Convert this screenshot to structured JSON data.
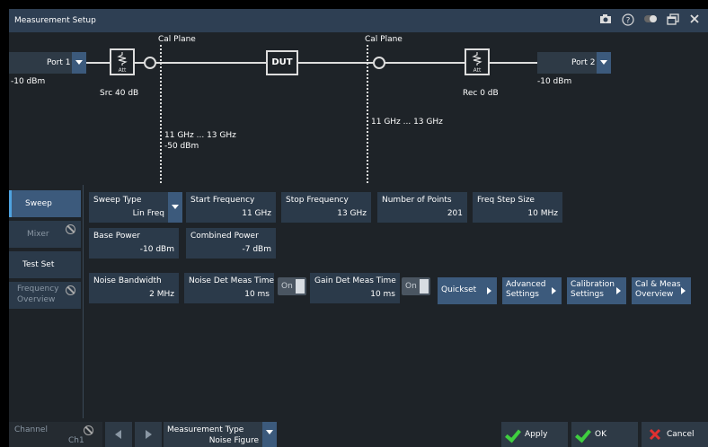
{
  "window": {
    "title": "Measurement Setup"
  },
  "titlebar_icons": [
    "camera-icon",
    "help-icon",
    "toggle-icon",
    "window-icon",
    "close-icon"
  ],
  "diagram": {
    "port1": {
      "label": "Port 1",
      "power": "-10 dBm"
    },
    "port2": {
      "label": "Port 2",
      "power": "-10 dBm"
    },
    "src_att": "Src 40 dB",
    "rec_att": "Rec 0 dB",
    "att_text": "Att",
    "dut": "DUT",
    "cal_plane_left": "Cal Plane",
    "cal_plane_right": "Cal Plane",
    "left_range": "11 GHz ... 13 GHz",
    "left_power": "-50 dBm",
    "right_range": "11 GHz ... 13 GHz"
  },
  "sidebar": {
    "items": [
      {
        "label": "Sweep",
        "state": "active"
      },
      {
        "label": "Mixer",
        "state": "disabled"
      },
      {
        "label": "Test Set",
        "state": "normal"
      },
      {
        "label": "Frequency",
        "label2": "Overview",
        "state": "disabled"
      }
    ]
  },
  "sweep": {
    "sweep_type": {
      "label": "Sweep Type",
      "value": "Lin Freq"
    },
    "start_freq": {
      "label": "Start Frequency",
      "value": "11 GHz"
    },
    "stop_freq": {
      "label": "Stop Frequency",
      "value": "13 GHz"
    },
    "num_points": {
      "label": "Number of Points",
      "value": "201"
    },
    "freq_step": {
      "label": "Freq Step Size",
      "value": "10 MHz"
    },
    "base_power": {
      "label": "Base Power",
      "value": "-10 dBm"
    },
    "combined_power": {
      "label": "Combined Power",
      "value": "-7 dBm"
    },
    "noise_bw": {
      "label": "Noise Bandwidth",
      "value": "2 MHz"
    },
    "noise_det": {
      "label": "Noise Det Meas Time",
      "value": "10 ms",
      "toggle": "On"
    },
    "gain_det": {
      "label": "Gain Det Meas Time",
      "value": "10 ms",
      "toggle": "On"
    },
    "quickset": "Quickset",
    "advanced": [
      "Advanced",
      "Settings"
    ],
    "calibration": [
      "Calibration",
      "Settings"
    ],
    "calmeas": [
      "Cal & Meas",
      "Overview"
    ]
  },
  "bottom": {
    "channel_label": "Channel",
    "channel_value": "Ch1",
    "meas_type_label": "Measurement Type",
    "meas_type_value": "Noise Figure",
    "apply": "Apply",
    "ok": "OK",
    "cancel": "Cancel"
  },
  "colors": {
    "accent": "#3c5a7c",
    "titlebar": "#2e3f53",
    "field": "#2b3a4a",
    "ok_green": "#3fcf3f",
    "cancel_red": "#e03030"
  }
}
